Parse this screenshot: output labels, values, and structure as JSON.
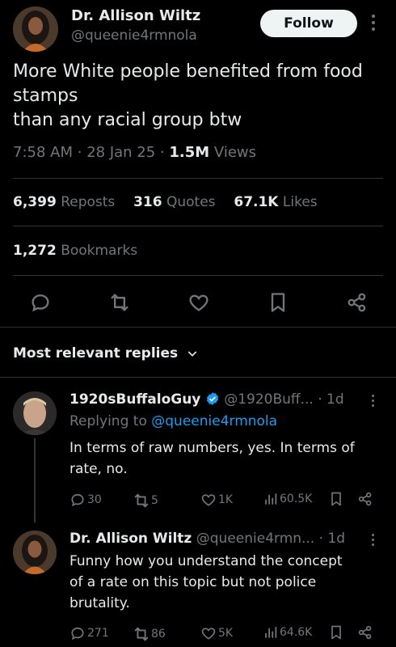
{
  "post": {
    "author_name": "Dr. Allison Wiltz",
    "author_handle": "@queenie4rmnola",
    "follow_label": "Follow",
    "text_line1": "More White people benefited from food",
    "text_line2": "stamps",
    "text_line3": "than any racial group btw",
    "time": "7:58 AM",
    "date": "28 Jan 25",
    "views_count": "1.5M",
    "views_label": "Views",
    "reposts_count": "6,399",
    "reposts_label": "Reposts",
    "quotes_count": "316",
    "quotes_label": "Quotes",
    "likes_count": "67.1K",
    "likes_label": "Likes",
    "bookmarks_count": "1,272",
    "bookmarks_label": "Bookmarks"
  },
  "replies_sort_label": "Most relevant replies",
  "replies": [
    {
      "name": "1920sBuffaloGuy",
      "handle": "@1920Buff...",
      "time": "1d",
      "replying_prefix": "Replying to",
      "replying_handle": "@queenie4rmnola",
      "text_line1": "In terms of raw numbers, yes. In terms of",
      "text_line2": "rate, no.",
      "replies": "30",
      "reposts": "5",
      "likes": "1K",
      "views": "60.5K"
    },
    {
      "name": "Dr. Allison Wiltz",
      "handle": "@queenie4rmn...",
      "time": "1d",
      "text_line1": "Funny how you understand the concept",
      "text_line2": "of a rate on this topic but not police",
      "text_line3": "brutality.",
      "replies": "271",
      "reposts": "86",
      "likes": "5K",
      "views": "64.6K"
    }
  ],
  "colors": {
    "background": "#000000",
    "text": "#e7e9ea",
    "muted": "#71767b",
    "link": "#1d9bf0",
    "verified": "#1d9bf0",
    "divider": "#2f3336"
  },
  "icons": [
    "reply-icon",
    "repost-icon",
    "like-icon",
    "bookmark-icon",
    "share-icon",
    "views-icon",
    "verified-badge-icon",
    "more-icon",
    "chevron-down-icon"
  ]
}
